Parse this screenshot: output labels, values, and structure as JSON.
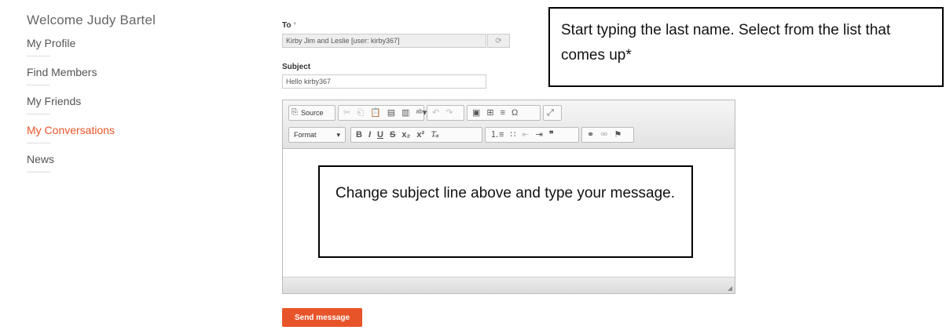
{
  "sidebar": {
    "welcome": "Welcome Judy Bartel",
    "items": [
      {
        "label": "My Profile",
        "active": false
      },
      {
        "label": "Find Members",
        "active": false
      },
      {
        "label": "My Friends",
        "active": false
      },
      {
        "label": "My Conversations",
        "active": true
      },
      {
        "label": "News",
        "active": false
      }
    ]
  },
  "form": {
    "to_label": "To",
    "to_required": "*",
    "to_value": "Kirby Jim and Leslie [user: kirby367]",
    "subject_label": "Subject",
    "subject_value": "Hello kirby367",
    "send_label": "Send message"
  },
  "editor": {
    "source_label": "Source",
    "format_label": "Format"
  },
  "callouts": {
    "recipient": "Start typing the last name.  Select from the list that comes up*",
    "message": "Change subject line above and type your message."
  },
  "colors": {
    "accent": "#e8542a"
  }
}
